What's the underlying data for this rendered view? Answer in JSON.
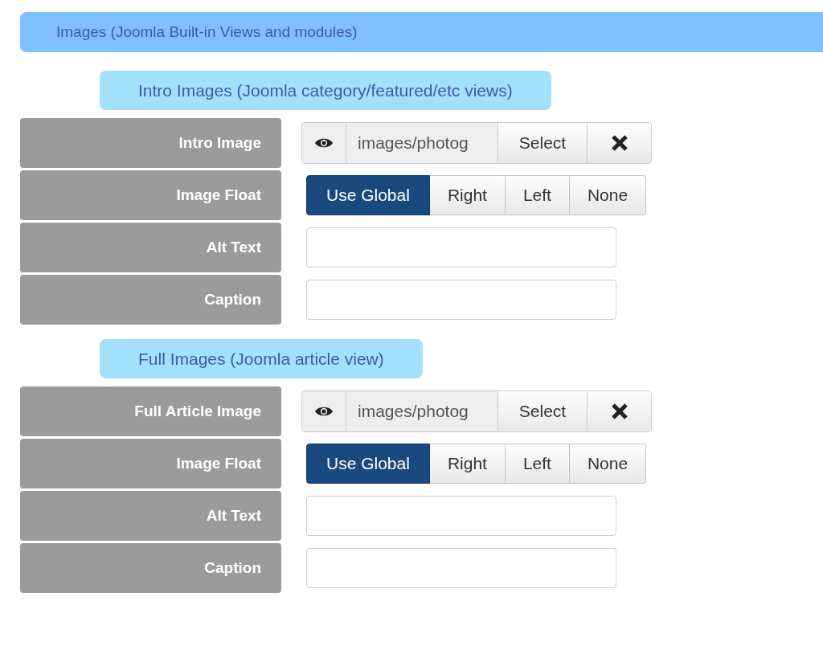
{
  "header": {
    "title": "Images (Joomla Built-in Views and modules)"
  },
  "sections": [
    {
      "title": "Intro Images (Joomla category/featured/etc views)",
      "fields": [
        {
          "kind": "media",
          "label": "Intro Image",
          "value": "images/photog",
          "button": "Select"
        },
        {
          "kind": "radio",
          "label": "Image Float",
          "options": [
            {
              "label": "Use Global",
              "selected": true
            },
            {
              "label": "Right",
              "selected": false
            },
            {
              "label": "Left",
              "selected": false
            },
            {
              "label": "None",
              "selected": false
            }
          ]
        },
        {
          "kind": "text",
          "label": "Alt Text"
        },
        {
          "kind": "text",
          "label": "Caption"
        }
      ]
    },
    {
      "title": "Full Images (Joomla article view)",
      "fields": [
        {
          "kind": "media",
          "label": "Full Article Image",
          "value": "images/photog",
          "button": "Select"
        },
        {
          "kind": "radio",
          "label": "Image Float",
          "options": [
            {
              "label": "Use Global",
              "selected": true
            },
            {
              "label": "Right",
              "selected": false
            },
            {
              "label": "Left",
              "selected": false
            },
            {
              "label": "None",
              "selected": false
            }
          ]
        },
        {
          "kind": "text",
          "label": "Alt Text"
        },
        {
          "kind": "text",
          "label": "Caption"
        }
      ]
    }
  ]
}
